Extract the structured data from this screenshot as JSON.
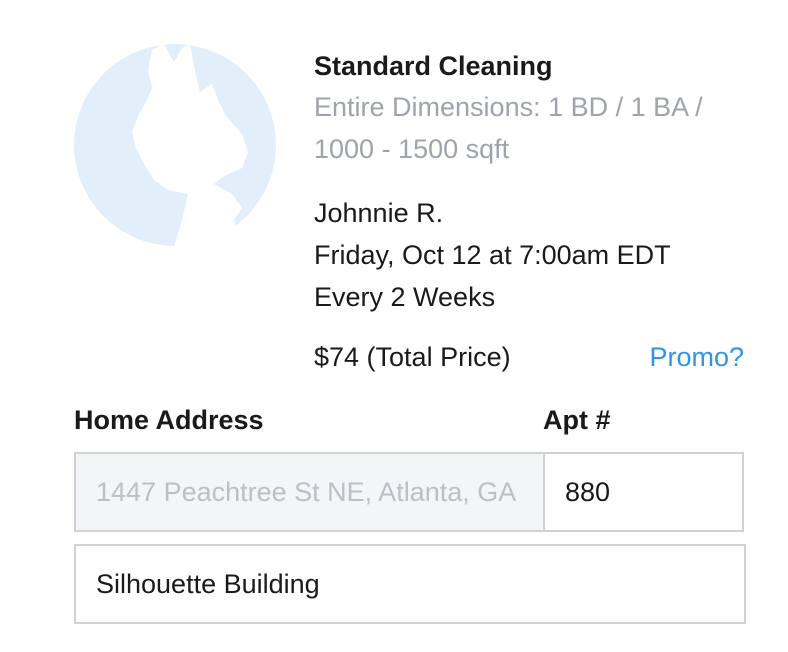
{
  "service": {
    "title": "Standard Cleaning",
    "dimensions": "Entire Dimensions: 1 BD / 1 BA / 1000 - 1500 sqft"
  },
  "booking": {
    "provider": "Johnnie R.",
    "datetime": "Friday, Oct 12 at 7:00am EDT",
    "frequency": "Every 2 Weeks",
    "price": "$74 (Total Price)",
    "promo_link": "Promo?"
  },
  "address_form": {
    "home_label": "Home Address",
    "apt_label": "Apt #",
    "address_placeholder": "1447 Peachtree St NE, Atlanta, GA",
    "apt_value": "880",
    "extra_value": "Silhouette Building"
  },
  "colors": {
    "avatar_bg": "#e3eefb",
    "link": "#2f95e6",
    "muted_text": "#9fa3ab"
  }
}
